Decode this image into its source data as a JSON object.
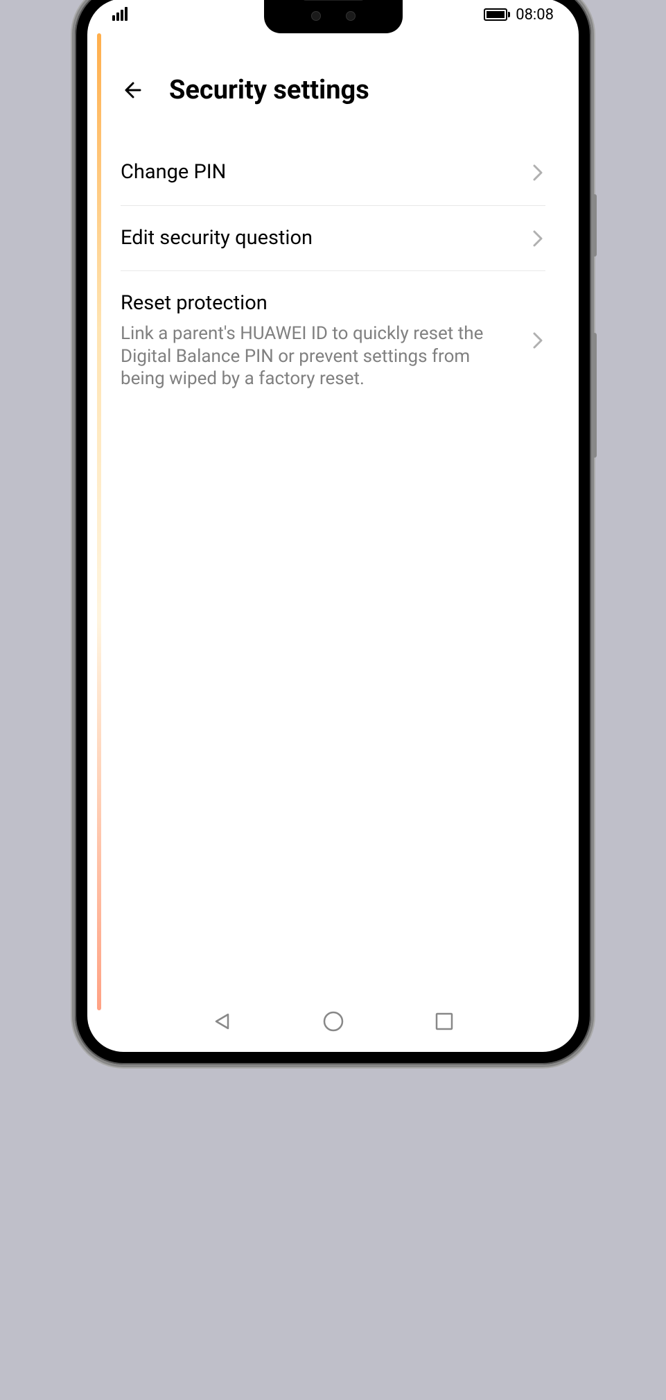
{
  "statusBar": {
    "time": "08:08"
  },
  "header": {
    "title": "Security settings"
  },
  "items": [
    {
      "title": "Change PIN",
      "subtitle": ""
    },
    {
      "title": "Edit security question",
      "subtitle": ""
    },
    {
      "title": "Reset protection",
      "subtitle": "Link a parent's HUAWEI ID to quickly reset the Digital Balance PIN or prevent settings from being wiped by a factory reset."
    }
  ]
}
